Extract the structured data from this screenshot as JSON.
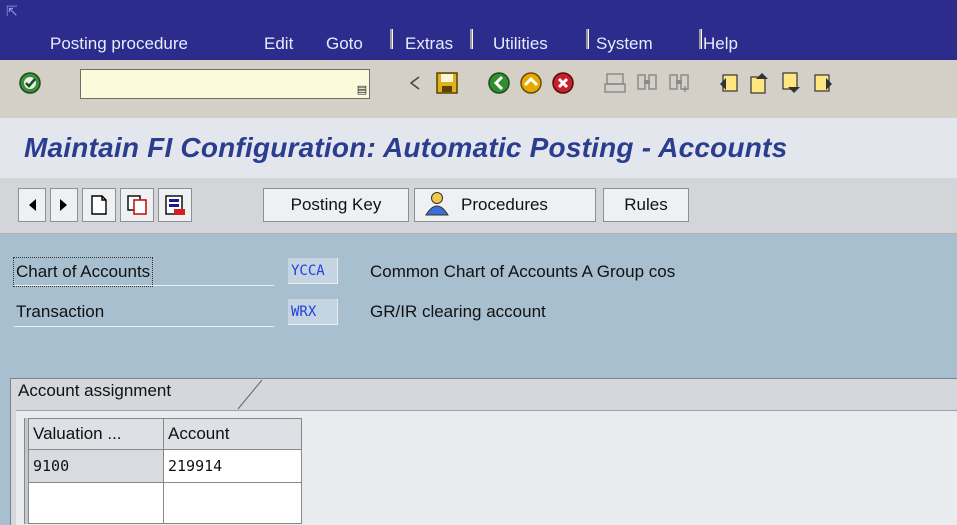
{
  "menubar": {
    "corner_glyph": "⇱",
    "items": [
      "Posting procedure",
      "Edit",
      "Goto",
      "Extras",
      "Utilities",
      "System",
      "Help"
    ]
  },
  "toolbar": {
    "command_value": "",
    "icons": [
      "enter-icon",
      "command-history-icon",
      "back-arrow-icon",
      "save-icon",
      "back-icon",
      "exit-icon",
      "cancel-icon",
      "print-icon",
      "find-icon",
      "find-next-icon",
      "first-page-icon",
      "previous-page-icon",
      "next-page-icon",
      "last-page-icon"
    ]
  },
  "title": {
    "text": "Maintain FI Configuration: Automatic Posting - Accounts"
  },
  "app_toolbar": {
    "posting_key_label": "Posting Key",
    "procedures_label": "Procedures",
    "rules_label": "Rules"
  },
  "header": {
    "chart_label": "Chart of Accounts",
    "chart_value": "YCCA",
    "chart_desc": "Common Chart of Accounts A Group cos",
    "transaction_label": "Transaction",
    "transaction_value": "WRX",
    "transaction_desc": "GR/IR clearing account"
  },
  "tab": {
    "label": "Account assignment"
  },
  "table": {
    "columns": [
      "Valuation ...",
      "Account"
    ],
    "rows": [
      [
        "9100",
        "219914"
      ],
      [
        "",
        ""
      ]
    ]
  },
  "colors": {
    "menubar_bg": "#2c2c8c",
    "title_color": "#2a3d8f",
    "background": "#a7bfcf",
    "key_value_text": "#2040e0"
  }
}
